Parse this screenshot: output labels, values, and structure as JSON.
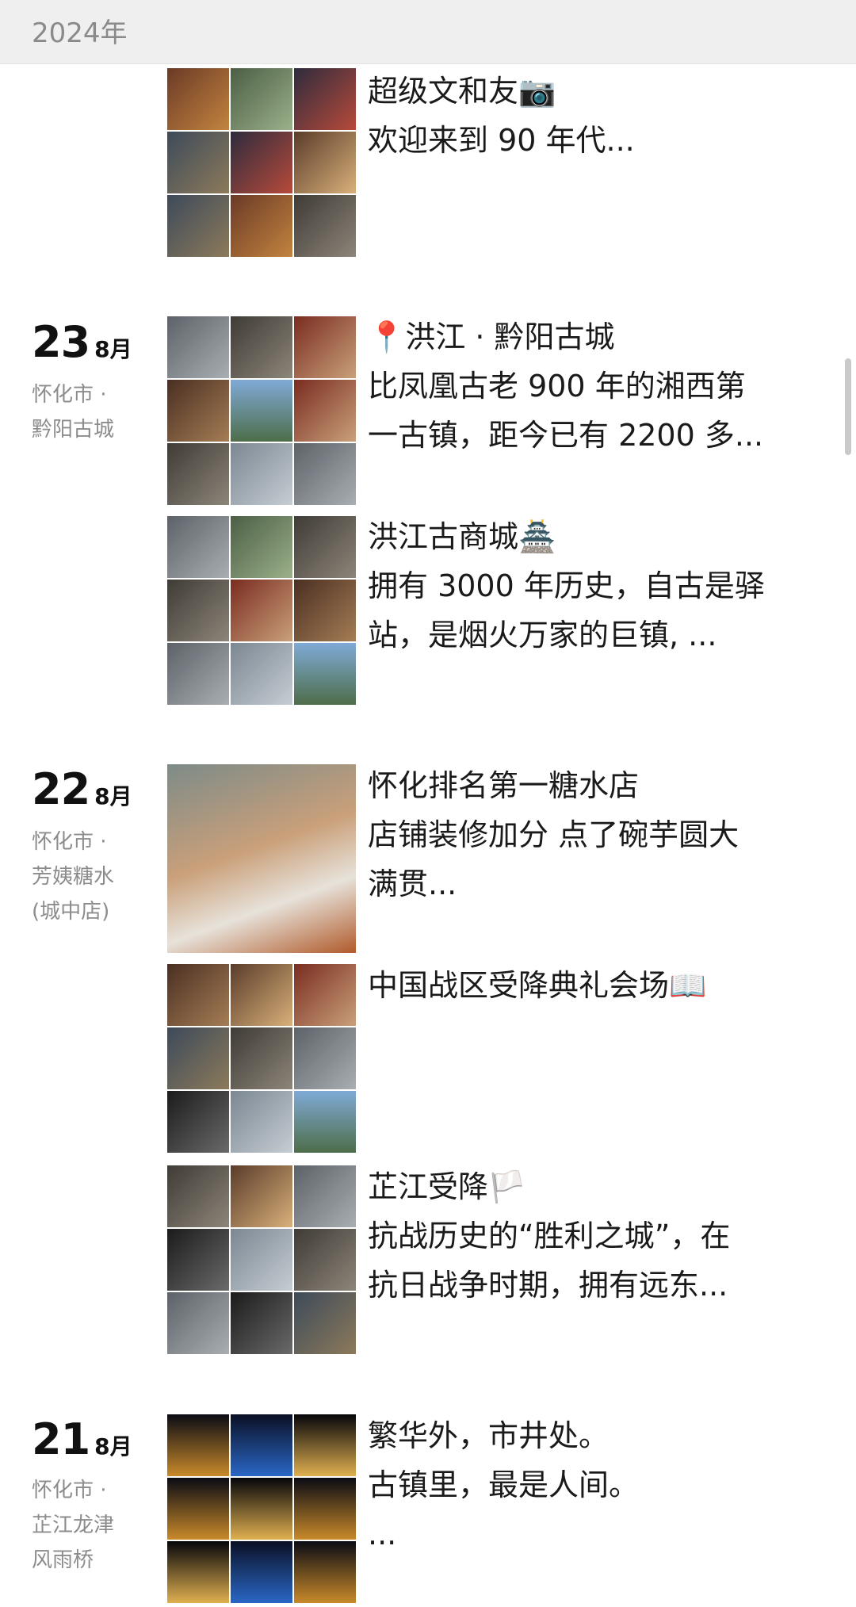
{
  "header": {
    "year": "2024年"
  },
  "posts": [
    {
      "id": "p1",
      "lines": [
        "超级文和友📷",
        "欢迎来到 90 年代..."
      ]
    },
    {
      "id": "p2",
      "lines": [
        "📍洪江 · 黔阳古城",
        "比凤凰古老 900 年的湘西第",
        "一古镇，距今已有 2200 多..."
      ]
    },
    {
      "id": "p3",
      "lines": [
        "洪江古商城🏯",
        "拥有 3000 年历史，自古是驿",
        "站，是烟火万家的巨镇, ..."
      ]
    },
    {
      "id": "p4",
      "lines": [
        "怀化排名第一糖水店",
        "店铺装修加分 点了碗芋圆大",
        "满贯..."
      ]
    },
    {
      "id": "p5",
      "lines": [
        "中国战区受降典礼会场📖"
      ]
    },
    {
      "id": "p6",
      "lines": [
        "芷江受降🏳️",
        "抗战历史的“胜利之城”，在",
        "抗日战争时期，拥有远东..."
      ]
    },
    {
      "id": "p7",
      "lines": [
        "繁华外，市井处。",
        "古镇里，最是人间。",
        "..."
      ]
    }
  ],
  "days": [
    {
      "day": "23",
      "month": "8月",
      "location": [
        "怀化市 ·",
        "黔阳古城"
      ]
    },
    {
      "day": "22",
      "month": "8月",
      "location": [
        "怀化市 ·",
        "芳姨糖水",
        "(城中店)"
      ]
    },
    {
      "day": "21",
      "month": "8月",
      "location": [
        "怀化市 ·",
        "芷江龙津",
        "风雨桥"
      ]
    }
  ]
}
